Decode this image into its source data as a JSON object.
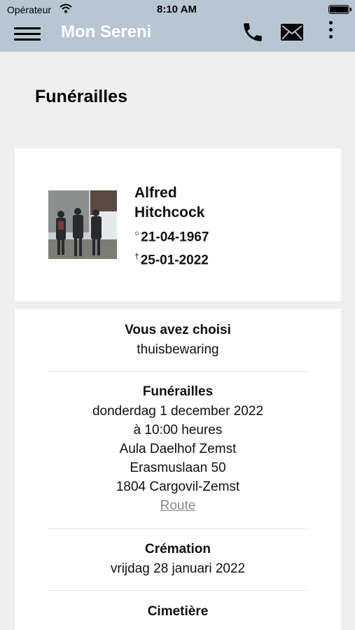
{
  "status": {
    "carrier": "Opérateur",
    "time": "8:10 AM"
  },
  "nav": {
    "title": "Mon Sereni"
  },
  "page": {
    "title": "Funérailles"
  },
  "person": {
    "name_line1": "Alfred",
    "name_line2": "Hitchcock",
    "birth_symbol": "○",
    "birth": "21-04-1967",
    "death_symbol": "†",
    "death": "25-01-2022"
  },
  "choice": {
    "label": "Vous avez choisi",
    "value": "thuisbewaring"
  },
  "funeral": {
    "label": "Funérailles",
    "date": "donderdag 1 december 2022",
    "time": "à 10:00 heures",
    "venue": "Aula Daelhof Zemst",
    "street": "Erasmuslaan 50",
    "city": "1804 Cargovil-Zemst",
    "route_label": "Route"
  },
  "cremation": {
    "label": "Crémation",
    "date": "vrijdag 28 januari 2022"
  },
  "cemetery": {
    "label": "Cimetière"
  },
  "colors": {
    "navbar": "#b8c6d3",
    "background": "#efefef",
    "link": "#8a8a8a"
  },
  "icons": [
    "wifi-icon",
    "battery-icon",
    "menu-icon",
    "phone-icon",
    "mail-icon",
    "more-vertical-icon"
  ]
}
